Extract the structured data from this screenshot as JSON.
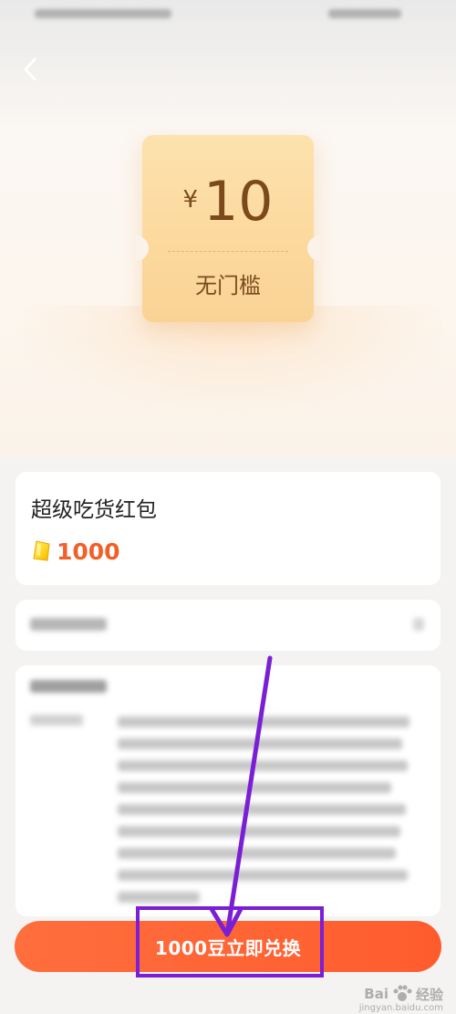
{
  "voucher": {
    "currency": "¥",
    "amount": "10",
    "condition": "无门槛"
  },
  "product": {
    "title": "超级吃货红包",
    "cost": "1000",
    "icon": "gold-bean-icon"
  },
  "action": {
    "redeem_label": "1000豆立即兑换"
  },
  "watermark": {
    "brand_left": "Bai",
    "brand_right": "经验",
    "url": "jingyan.baidu.com"
  },
  "colors": {
    "accent": "#ff5c2e",
    "price_text": "#f2602a",
    "voucher_bg": "#fcd99e",
    "voucher_text": "#7a4a1d",
    "annotation": "#7a1fd6"
  }
}
